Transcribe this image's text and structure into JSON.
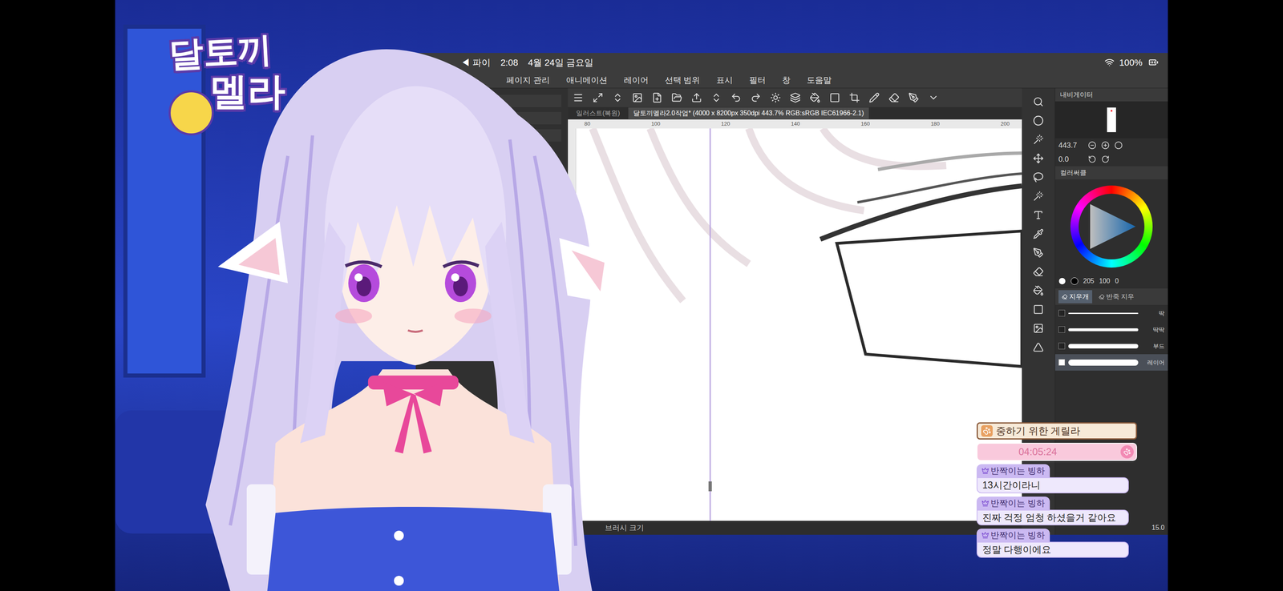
{
  "logo": {
    "line1": "달토끼",
    "line2": "멜라"
  },
  "app": {
    "status_bar": {
      "back": "◀ 파이",
      "time": "2:08",
      "date": "4월 24일 금요일",
      "battery": "100%"
    },
    "menu": [
      "페이지 관리",
      "애니메이션",
      "레이어",
      "선택 범위",
      "표시",
      "필터",
      "창",
      "도움말"
    ],
    "tabs": [
      {
        "label": "일러스트(복원)",
        "selected": false
      },
      {
        "label": "달토끼멜라2.0작업* (4000 x 8200px 350dpi 443.7% RGB:sRGB IEC61966-2.1)",
        "selected": true
      }
    ],
    "ruler": [
      "80",
      "100",
      "120",
      "140",
      "160",
      "180",
      "200"
    ],
    "navigator": {
      "title": "내비게이터",
      "zoom": "443.7",
      "rotation": "0.0"
    },
    "color": {
      "title": "컬러써클",
      "values": [
        "205",
        "100",
        "0"
      ]
    },
    "tool_tabs": [
      {
        "label": "지우개",
        "selected": true
      },
      {
        "label": "반죽 지우",
        "selected": false
      }
    ],
    "brushes": [
      {
        "name": "딱",
        "checked": false
      },
      {
        "name": "딱딱",
        "checked": false
      },
      {
        "name": "부드",
        "checked": false
      },
      {
        "name": "레이어",
        "checked": true
      }
    ],
    "brush_size": {
      "label": "브러시 크기",
      "value": "15.0"
    }
  },
  "chat": {
    "title": "중하기 위한 게릴라",
    "timer": "04:05:24",
    "messages": [
      {
        "user": "반짝이는 빙하",
        "text": "13시간이라니"
      },
      {
        "user": "반짝이는 빙하",
        "text": "진짜 걱정 엄청 하셨을거 같아요"
      },
      {
        "user": "반짝이는 빙하",
        "text": "정말 다행이에요"
      }
    ]
  }
}
